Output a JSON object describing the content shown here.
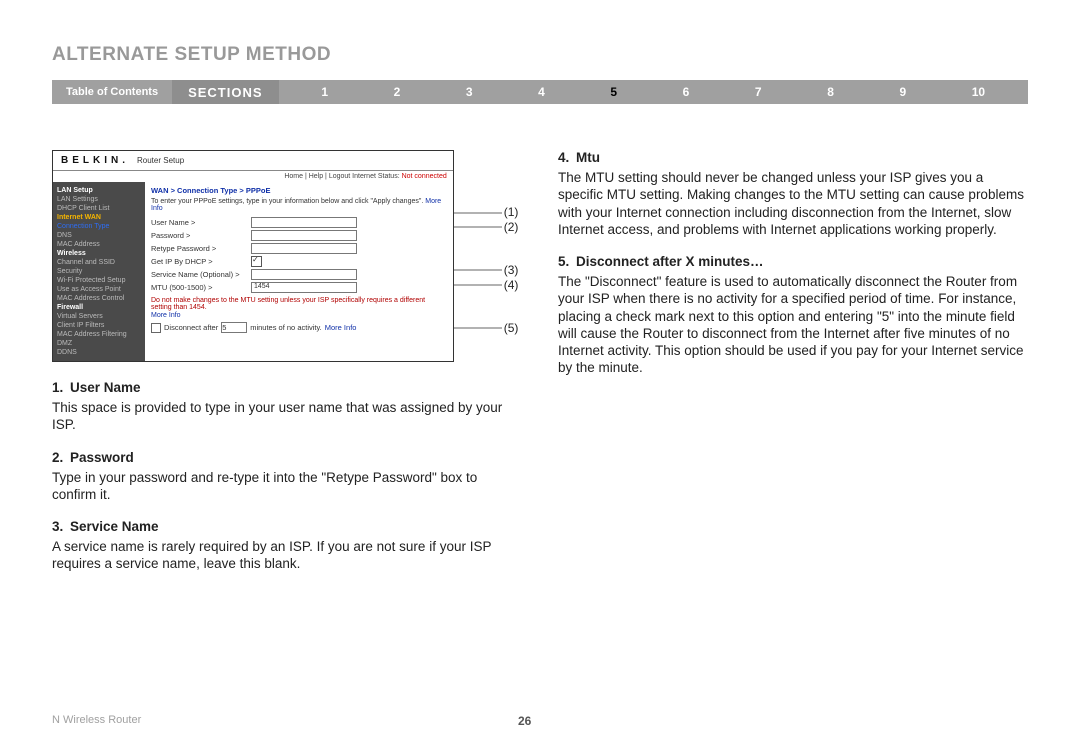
{
  "header": {
    "title": "Alternate Setup Method"
  },
  "nav": {
    "toc": "Table of Contents",
    "sections_label": "sections",
    "active": "5",
    "numbers": [
      "1",
      "2",
      "3",
      "4",
      "5",
      "6",
      "7",
      "8",
      "9",
      "10"
    ]
  },
  "router": {
    "logo": "BELKIN.",
    "subtitle": "Router Setup",
    "top_links": "Home | Help | Logout   Internet Status:",
    "status": "Not connected",
    "sidebar": {
      "g1": "LAN Setup",
      "g1a": "LAN Settings",
      "g1b": "DHCP Client List",
      "g2": "Internet WAN",
      "g2a": "Connection Type",
      "g2b": "DNS",
      "g2c": "MAC Address",
      "g3": "Wireless",
      "g3a": "Channel and SSID",
      "g3b": "Security",
      "g3c": "Wi-Fi Protected Setup",
      "g3d": "Use as Access Point",
      "g3e": "MAC Address Control",
      "g4": "Firewall",
      "g4a": "Virtual Servers",
      "g4b": "Client IP Filters",
      "g4c": "MAC Address Filtering",
      "g4d": "DMZ",
      "g4e": "DDNS"
    },
    "breadcrumb": "WAN > Connection Type > PPPoE",
    "intro": "To enter your PPPoE settings, type in your information below and click \"Apply changes\".",
    "more_info": "More Info",
    "fields": {
      "user": "User Name >",
      "pass": "Password >",
      "retype": "Retype Password >",
      "dhcp": "Get IP By DHCP >",
      "service": "Service Name (Optional) >",
      "mtu": "MTU (500-1500) >",
      "mtu_val": "1454"
    },
    "warn": "Do not make changes to the MTU setting unless your ISP specifically requires a different setting than 1454.",
    "disconnect_pre": "Disconnect after",
    "disconnect_post": "minutes of no activity.",
    "disconnect_val": "5"
  },
  "callouts": {
    "c1": "(1)",
    "c2": "(2)",
    "c3": "(3)",
    "c4": "(4)",
    "c5": "(5)"
  },
  "left_items": {
    "h1_num": "1.",
    "h1": "User Name",
    "p1": "This space is provided to type in your user name that was assigned by your ISP.",
    "h2_num": "2.",
    "h2": "Password",
    "p2": "Type in your password and re-type it into the \"Retype Password\" box to confirm it.",
    "h3_num": "3.",
    "h3": "Service Name",
    "p3": "A service name is rarely required by an ISP. If you are not sure if your ISP requires a service name, leave this blank."
  },
  "right_items": {
    "h4_num": "4.",
    "h4": "Mtu",
    "p4": "The MTU setting should never be changed unless your ISP gives you a specific MTU setting. Making changes to the MTU setting can cause problems with your Internet connection including disconnection from the Internet, slow Internet access, and problems with Internet applications working properly.",
    "h5_num": "5.",
    "h5": "Disconnect after X minutes…",
    "p5": "The \"Disconnect\" feature is used to automatically disconnect the Router from your ISP when there is no activity for a specified period of time. For instance, placing a check mark next to this option and entering \"5\" into the minute field will cause the Router to disconnect from the Internet after five minutes of no Internet activity. This option should be used if you pay for your Internet service by the minute."
  },
  "footer": {
    "left": "N Wireless Router",
    "page": "26"
  }
}
